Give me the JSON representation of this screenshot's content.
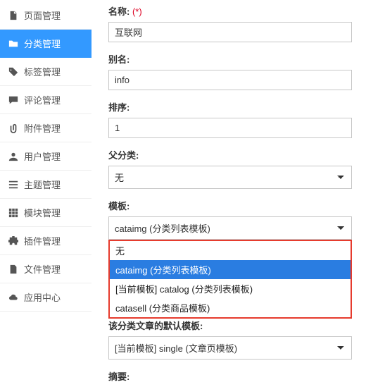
{
  "sidebar": {
    "items": [
      {
        "label": "页面管理",
        "icon": "file-icon"
      },
      {
        "label": "分类管理",
        "icon": "folder-icon"
      },
      {
        "label": "标签管理",
        "icon": "tags-icon"
      },
      {
        "label": "评论管理",
        "icon": "comment-icon"
      },
      {
        "label": "附件管理",
        "icon": "paperclip-icon"
      },
      {
        "label": "用户管理",
        "icon": "users-icon"
      },
      {
        "label": "主题管理",
        "icon": "list-icon"
      },
      {
        "label": "模块管理",
        "icon": "grid-icon"
      },
      {
        "label": "插件管理",
        "icon": "puzzle-icon"
      },
      {
        "label": "文件管理",
        "icon": "doc-icon"
      },
      {
        "label": "应用中心",
        "icon": "cloud-icon"
      }
    ],
    "active_index": 1
  },
  "form": {
    "name": {
      "label": "名称:",
      "required_mark": "(*)",
      "value": "互联网"
    },
    "alias": {
      "label": "别名:",
      "value": "info"
    },
    "order": {
      "label": "排序:",
      "value": "1"
    },
    "parent": {
      "label": "父分类:",
      "value": "无"
    },
    "template": {
      "label": "模板:",
      "value": "cataimg (分类列表模板)",
      "options": [
        "无",
        "cataimg (分类列表模板)",
        "[当前模板] catalog (分类列表模板)",
        "catasell (分类商品模板)"
      ],
      "selected_index": 1
    },
    "default_article_template": {
      "label": "该分类文章的默认模板:",
      "value": "[当前模板] single (文章页模板)"
    },
    "summary": {
      "label": "摘要:"
    }
  },
  "colors": {
    "accent": "#3399ff",
    "highlight_border": "#e63b2d",
    "select_highlight": "#2a7de1"
  }
}
